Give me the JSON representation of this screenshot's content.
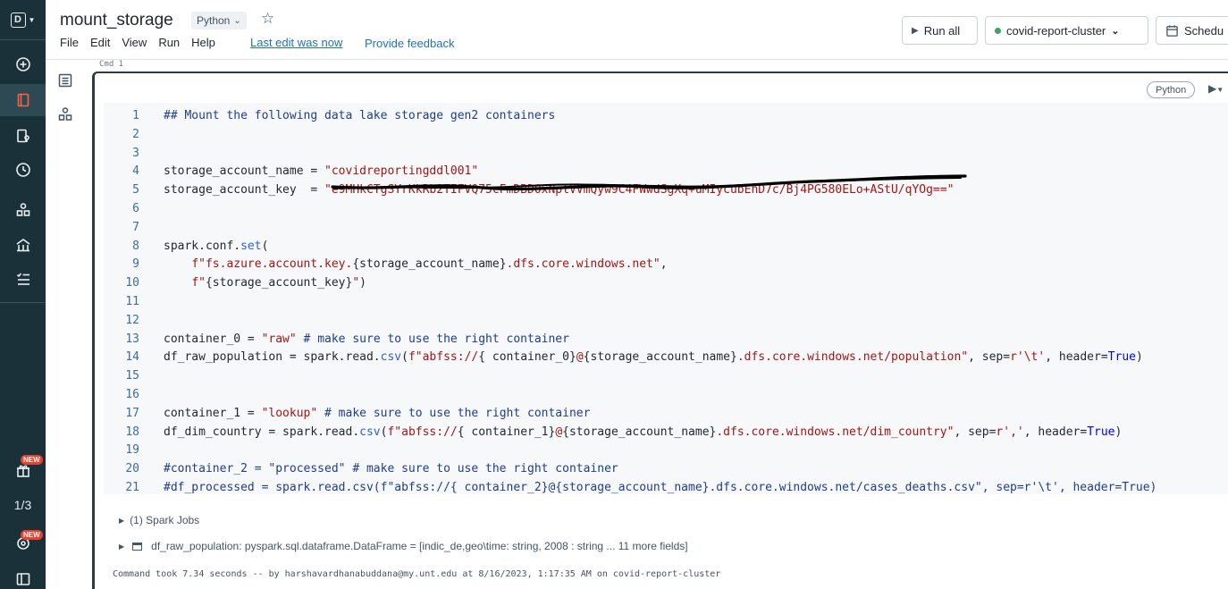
{
  "rail": {
    "logo_letter": "D",
    "new_badge_1": "NEW",
    "new_badge_2": "NEW",
    "pages": "1/3"
  },
  "header": {
    "title": "mount_storage",
    "language": "Python",
    "menu": [
      "File",
      "Edit",
      "View",
      "Run",
      "Help"
    ],
    "last_edit": "Last edit was now",
    "feedback": "Provide feedback",
    "run_all": "Run all",
    "cluster": "covid-report-cluster",
    "schedule": "Schedu"
  },
  "cell": {
    "cmd_label": "Cmd 1",
    "language_badge": "Python",
    "lines": [
      {
        "n": "1",
        "t": "## Mount the following data lake storage gen2 containers"
      },
      {
        "n": "2",
        "t": ""
      },
      {
        "n": "3",
        "t": ""
      },
      {
        "n": "4",
        "t": "storage_account_name = \"covidreportingddl001\""
      },
      {
        "n": "5",
        "t": "storage_account_key  = \"e9MHkCTgSYrKkRb2TIFVQ75cFmDBD0xNplVVmQyw9C4FWwdSgXq+uMIycubEnD7c/Bj4PG580ELo+AStU/qYOg==\""
      },
      {
        "n": "6",
        "t": ""
      },
      {
        "n": "7",
        "t": ""
      },
      {
        "n": "8",
        "t": "spark.conf.set("
      },
      {
        "n": "9",
        "t": "    f\"fs.azure.account.key.{storage_account_name}.dfs.core.windows.net\","
      },
      {
        "n": "10",
        "t": "    f\"{storage_account_key}\")"
      },
      {
        "n": "11",
        "t": ""
      },
      {
        "n": "12",
        "t": ""
      },
      {
        "n": "13",
        "t": "container_0 = \"raw\" # make sure to use the right container"
      },
      {
        "n": "14",
        "t": "df_raw_population = spark.read.csv(f\"abfss://{ container_0}@{storage_account_name}.dfs.core.windows.net/population\", sep=r'\\t', header=True)"
      },
      {
        "n": "15",
        "t": ""
      },
      {
        "n": "16",
        "t": ""
      },
      {
        "n": "17",
        "t": "container_1 = \"lookup\" # make sure to use the right container"
      },
      {
        "n": "18",
        "t": "df_dim_country = spark.read.csv(f\"abfss://{ container_1}@{storage_account_name}.dfs.core.windows.net/dim_country\", sep=r',', header=True)"
      },
      {
        "n": "19",
        "t": ""
      },
      {
        "n": "20",
        "t": "#container_2 = \"processed\" # make sure to use the right container"
      },
      {
        "n": "21",
        "t": "#df_processed = spark.read.csv(f\"abfss://{ container_2}@{storage_account_name}.dfs.core.windows.net/cases_deaths.csv\", sep=r'\\t', header=True)"
      }
    ],
    "spark_jobs": "(1) Spark Jobs",
    "df_result": "df_raw_population:  pyspark.sql.dataframe.DataFrame = [indic_de,geo\\time: string, 2008 : string ... 11 more fields]",
    "command_took": "Command took 7.34 seconds -- by harshavardhanabuddana@my.unt.edu at 8/16/2023, 1:17:35 AM on covid-report-cluster"
  },
  "colors": {
    "rail_bg": "#1b3139",
    "accent": "#ff5f46",
    "link": "#2272b4",
    "cluster_dot": "#3ba55c",
    "new_badge": "#e9412e"
  }
}
